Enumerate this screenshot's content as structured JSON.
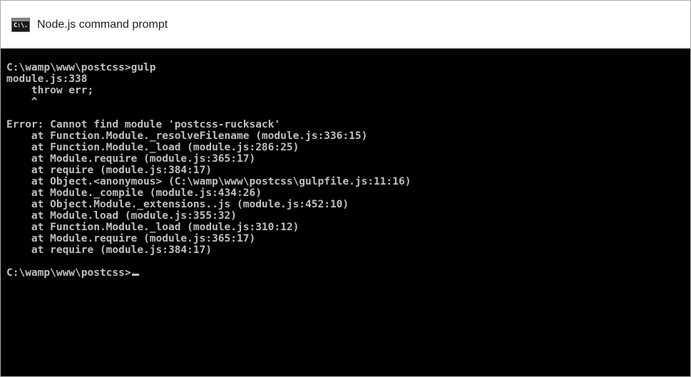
{
  "window": {
    "title": "Node.js command prompt",
    "icon": "console-window-icon",
    "icon_glyph": "C:\\."
  },
  "console": {
    "lines": [
      "C:\\wamp\\www\\postcss>gulp",
      "module.js:338",
      "    throw err;",
      "    ^",
      "",
      "Error: Cannot find module 'postcss-rucksack'",
      "    at Function.Module._resolveFilename (module.js:336:15)",
      "    at Function.Module._load (module.js:286:25)",
      "    at Module.require (module.js:365:17)",
      "    at require (module.js:384:17)",
      "    at Object.<anonymous> (C:\\wamp\\www\\postcss\\gulpfile.js:11:16)",
      "    at Module._compile (module.js:434:26)",
      "    at Object.Module._extensions..js (module.js:452:10)",
      "    at Module.load (module.js:355:32)",
      "    at Function.Module._load (module.js:310:12)",
      "    at Module.require (module.js:365:17)",
      "    at require (module.js:384:17)",
      ""
    ],
    "prompt": "C:\\wamp\\www\\postcss>",
    "text_color": "#c0c0c0",
    "background_color": "#000000"
  }
}
